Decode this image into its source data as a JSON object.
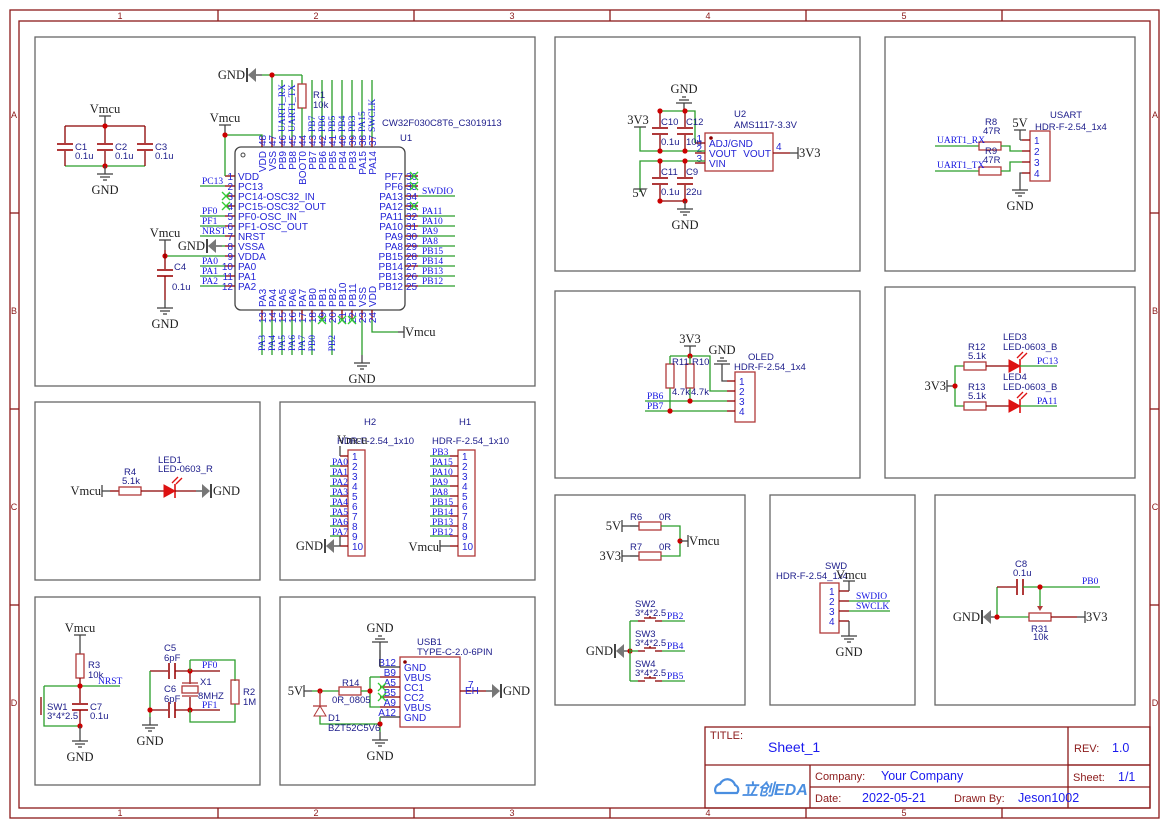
{
  "frame": {
    "cols": [
      "1",
      "2",
      "3",
      "4",
      "5"
    ],
    "rows": [
      "A",
      "B",
      "C",
      "D"
    ]
  },
  "power": {
    "gnd": "GND",
    "vmcu": "Vmcu",
    "v33": "3V3",
    "v5": "5V"
  },
  "colors": {
    "wire": "#2a9d2a",
    "component": "#b03a3a",
    "pin": "#8b0000",
    "frame": "#8b1a1a",
    "panel": "#666666",
    "text_blue": "#2424d6",
    "junction": "#cc0000"
  },
  "caps1": {
    "c1": "C1",
    "c1v": "0.1u",
    "c2": "C2",
    "c2v": "0.1u",
    "c3": "C3",
    "c3v": "0.1u"
  },
  "u1": {
    "ref": "U1",
    "part": "CW32F030C8T6_C3019113",
    "r1": "R1",
    "r1v": "10k",
    "c4": "C4",
    "c4v": "0.1u",
    "left": [
      {
        "n": "1",
        "name": "VDD",
        "net": ""
      },
      {
        "n": "2",
        "name": "PC13",
        "net": "PC13"
      },
      {
        "n": "3",
        "name": "PC14-OSC32_IN",
        "net": "",
        "nc": true
      },
      {
        "n": "4",
        "name": "PC15-OSC32_OUT",
        "net": "",
        "nc": true
      },
      {
        "n": "5",
        "name": "PF0-OSC_IN",
        "net": "PF0"
      },
      {
        "n": "6",
        "name": "PF1-OSC_OUT",
        "net": "PF1"
      },
      {
        "n": "7",
        "name": "NRST",
        "net": "NRST"
      },
      {
        "n": "8",
        "name": "VSSA",
        "net": ""
      },
      {
        "n": "9",
        "name": "VDDA",
        "net": ""
      },
      {
        "n": "10",
        "name": "PA0",
        "net": "PA0"
      },
      {
        "n": "11",
        "name": "PA1",
        "net": "PA1"
      },
      {
        "n": "12",
        "name": "PA2",
        "net": "PA2"
      }
    ],
    "top": [
      {
        "n": "48",
        "name": "VDD",
        "net": ""
      },
      {
        "n": "47",
        "name": "VSS",
        "net": ""
      },
      {
        "n": "46",
        "name": "PB9",
        "net": "UART1_RX"
      },
      {
        "n": "45",
        "name": "PB8",
        "net": "UART1_TX"
      },
      {
        "n": "44",
        "name": "BOOT0",
        "net": ""
      },
      {
        "n": "43",
        "name": "PB7",
        "net": "PB7"
      },
      {
        "n": "42",
        "name": "PB6",
        "net": "PB6"
      },
      {
        "n": "41",
        "name": "PB5",
        "net": "PB5"
      },
      {
        "n": "40",
        "name": "PB4",
        "net": "PB4"
      },
      {
        "n": "39",
        "name": "PB3",
        "net": "PB3"
      },
      {
        "n": "38",
        "name": "PA15",
        "net": "PA15"
      },
      {
        "n": "37",
        "name": "PA14",
        "net": "SWCLK"
      }
    ],
    "right": [
      {
        "n": "36",
        "name": "PF7",
        "net": "",
        "nc": true
      },
      {
        "n": "35",
        "name": "PF6",
        "net": "",
        "nc": true
      },
      {
        "n": "34",
        "name": "PA13",
        "net": "SWDIO"
      },
      {
        "n": "33",
        "name": "PA12",
        "net": "",
        "nc": true
      },
      {
        "n": "32",
        "name": "PA11",
        "net": "PA11"
      },
      {
        "n": "31",
        "name": "PA10",
        "net": "PA10"
      },
      {
        "n": "30",
        "name": "PA9",
        "net": "PA9"
      },
      {
        "n": "29",
        "name": "PA8",
        "net": "PA8"
      },
      {
        "n": "28",
        "name": "PB15",
        "net": "PB15"
      },
      {
        "n": "27",
        "name": "PB14",
        "net": "PB14"
      },
      {
        "n": "26",
        "name": "PB13",
        "net": "PB13"
      },
      {
        "n": "25",
        "name": "PB12",
        "net": "PB12"
      }
    ],
    "bottom": [
      {
        "n": "13",
        "name": "PA3",
        "net": "PA3"
      },
      {
        "n": "14",
        "name": "PA4",
        "net": "PA4"
      },
      {
        "n": "15",
        "name": "PA5",
        "net": "PA5"
      },
      {
        "n": "16",
        "name": "PA6",
        "net": "PA6"
      },
      {
        "n": "17",
        "name": "PA7",
        "net": "PA7"
      },
      {
        "n": "18",
        "name": "PB0",
        "net": "PB0"
      },
      {
        "n": "19",
        "name": "PB1",
        "net": "",
        "nc": true
      },
      {
        "n": "20",
        "name": "PB2",
        "net": "PB2"
      },
      {
        "n": "21",
        "name": "PB10",
        "net": "",
        "nc": true
      },
      {
        "n": "22",
        "name": "PB11",
        "net": "",
        "nc": true
      },
      {
        "n": "23",
        "name": "VSS",
        "net": ""
      },
      {
        "n": "24",
        "name": "VDD",
        "net": ""
      }
    ]
  },
  "u2": {
    "ref": "U2",
    "part": "AMS1117-3.3V",
    "p1": "1",
    "p1name": "ADJ/GND",
    "p2": "2",
    "p2name": "VOUT",
    "p3": "3",
    "p3name": "VIN",
    "p4": "4",
    "p4name": "VOUT",
    "c10": "C10",
    "c10v": "0.1u",
    "c12": "C12",
    "c12v": "10u",
    "c11": "C11",
    "c11v": "0.1u",
    "c9": "C9",
    "c9v": "22u"
  },
  "usart": {
    "ref": "USART",
    "part": "HDR-F-2.54_1x4",
    "r8": "R8",
    "r8v": "47R",
    "r9": "R9",
    "r9v": "47R",
    "rx": "UART1_RX",
    "tx": "UART1_TX",
    "pins": [
      "1",
      "2",
      "3",
      "4"
    ]
  },
  "oled": {
    "ref": "OLED",
    "part": "HDR-F-2.54_1x4",
    "r11": "R11",
    "r11v": "4.7k",
    "r10": "R10",
    "r10v": "4.7k",
    "pb6": "PB6",
    "pb7": "PB7",
    "pins": [
      "1",
      "2",
      "3",
      "4"
    ]
  },
  "leds": {
    "r12": "R12",
    "r12v": "5.1k",
    "r13": "R13",
    "r13v": "5.1k",
    "led3": "LED3",
    "led3p": "LED-0603_B",
    "led4": "LED4",
    "led4p": "LED-0603_B",
    "pc13": "PC13",
    "pa11": "PA11"
  },
  "led1": {
    "r4": "R4",
    "r4v": "5.1k",
    "led": "LED1",
    "ledp": "LED-0603_R"
  },
  "h2": {
    "ref": "H2",
    "part": "HDR-F-2.54_1x10",
    "pins": [
      "1",
      "2",
      "3",
      "4",
      "5",
      "6",
      "7",
      "8",
      "9",
      "10"
    ],
    "nets": [
      "",
      "PA0",
      "PA1",
      "PA2",
      "PA3",
      "PA4",
      "PA5",
      "PA6",
      "PA7",
      ""
    ]
  },
  "h1": {
    "ref": "H1",
    "part": "HDR-F-2.54_1x10",
    "pins": [
      "1",
      "2",
      "3",
      "4",
      "5",
      "6",
      "7",
      "8",
      "9",
      "10"
    ],
    "nets": [
      "PB3",
      "PA15",
      "PA10",
      "PA9",
      "PA8",
      "PB15",
      "PB14",
      "PB13",
      "PB12",
      ""
    ]
  },
  "sel": {
    "r6": "R6",
    "r6v": "0R",
    "r7": "R7",
    "r7v": "0R"
  },
  "sw": [
    {
      "ref": "SW2",
      "part": "3*4*2.5",
      "net": "PB2"
    },
    {
      "ref": "SW3",
      "part": "3*4*2.5",
      "net": "PB4"
    },
    {
      "ref": "SW4",
      "part": "3*4*2.5",
      "net": "PB5"
    }
  ],
  "swd": {
    "ref": "SWD",
    "part": "HDR-F-2.54_1x4",
    "pins": [
      "1",
      "2",
      "3",
      "4"
    ],
    "swdio": "SWDIO",
    "swclk": "SWCLK"
  },
  "adc": {
    "c8": "C8",
    "c8v": "0.1u",
    "r31": "R31",
    "r31v": "10k",
    "pb0": "PB0"
  },
  "reset": {
    "r3": "R3",
    "r3v": "10k",
    "nrst": "NRST",
    "sw1": "SW1",
    "sw1p": "3*4*2.5",
    "c7": "C7",
    "c7v": "0.1u"
  },
  "xtal": {
    "c5": "C5",
    "c5v": "6pF",
    "c6": "C6",
    "c6v": "6pF",
    "x1": "X1",
    "x1v": "8MHZ",
    "r2": "R2",
    "r2v": "1M",
    "pf0": "PF0",
    "pf1": "PF1"
  },
  "usb": {
    "ref": "USB1",
    "part": "TYPE-C-2.0-6PIN",
    "pins": [
      {
        "n": "B12",
        "name": "GND"
      },
      {
        "n": "B9",
        "name": "VBUS"
      },
      {
        "n": "A5",
        "name": "CC1"
      },
      {
        "n": "B5",
        "name": "CC2"
      },
      {
        "n": "A9",
        "name": "VBUS"
      },
      {
        "n": "A12",
        "name": "GND"
      }
    ],
    "eh": "EH",
    "ehn": "7",
    "r14": "R14",
    "r14v": "0R_0805",
    "d1": "D1",
    "d1v": "BZT52C5V6"
  },
  "title_block": {
    "title_label": "TITLE:",
    "title": "Sheet_1",
    "rev_label": "REV:",
    "rev": "1.0",
    "company_label": "Company:",
    "company": "Your Company",
    "sheet_label": "Sheet:",
    "sheet": "1/1",
    "date_label": "Date:",
    "date": "2022-05-21",
    "drawn_label": "Drawn By:",
    "drawn": "Jeson1002",
    "logo": "立创EDA"
  }
}
